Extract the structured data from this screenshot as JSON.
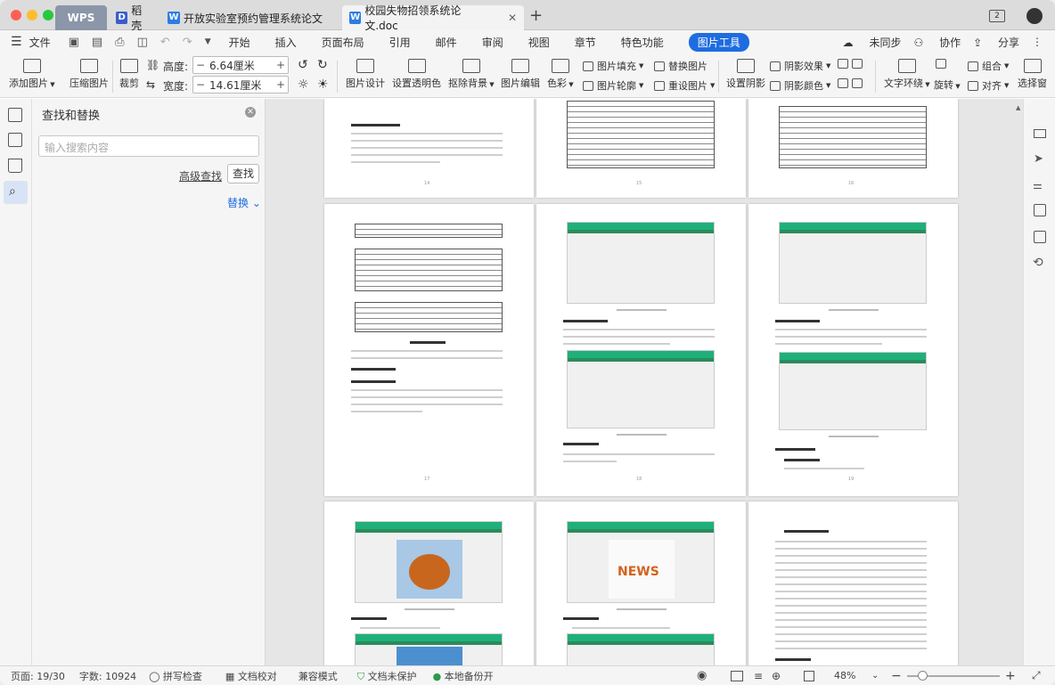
{
  "tabs": {
    "wps": "WPS",
    "daoke": "稻壳",
    "doc1": "开放实验室预约管理系统论文",
    "doc2": "校园失物招领系统论文.doc"
  },
  "menu": {
    "file": "文件",
    "items": [
      "开始",
      "插入",
      "页面布局",
      "引用",
      "邮件",
      "审阅",
      "视图",
      "章节",
      "特色功能",
      "图片工具"
    ],
    "right": {
      "sync": "未同步",
      "collab": "协作",
      "share": "分享"
    }
  },
  "ribbon": {
    "add_image": "添加图片",
    "compress": "压缩图片",
    "crop": "裁剪",
    "height_label": "高度:",
    "height_value": "6.64厘米",
    "width_label": "宽度:",
    "width_value": "14.61厘米",
    "design": "图片设计",
    "transparent": "设置透明色",
    "remove_bg": "抠除背景",
    "edit": "图片编辑",
    "color": "色彩",
    "fill": "图片填充",
    "outline": "图片轮廓",
    "replace": "替换图片",
    "reset": "重设图片",
    "shadow": "设置阴影",
    "shadow_effect": "阴影效果",
    "shadow_color": "阴影颜色",
    "wrap": "文字环绕",
    "rotate": "旋转",
    "group": "组合",
    "align": "对齐",
    "select_pane": "选择窗"
  },
  "find_pane": {
    "title": "查找和替换",
    "placeholder": "输入搜索内容",
    "advanced": "高级查找",
    "find_button": "查找",
    "replace": "替换"
  },
  "status": {
    "page": "页面: 19/30",
    "words": "字数: 10924",
    "spell": "拼写检查",
    "proof": "文档校对",
    "compat": "兼容模式",
    "unprotected": "文档未保护",
    "backup": "本地备份开",
    "zoom": "48%"
  },
  "colors": {
    "accent": "#1f6ce0",
    "green": "#1fb07a"
  }
}
